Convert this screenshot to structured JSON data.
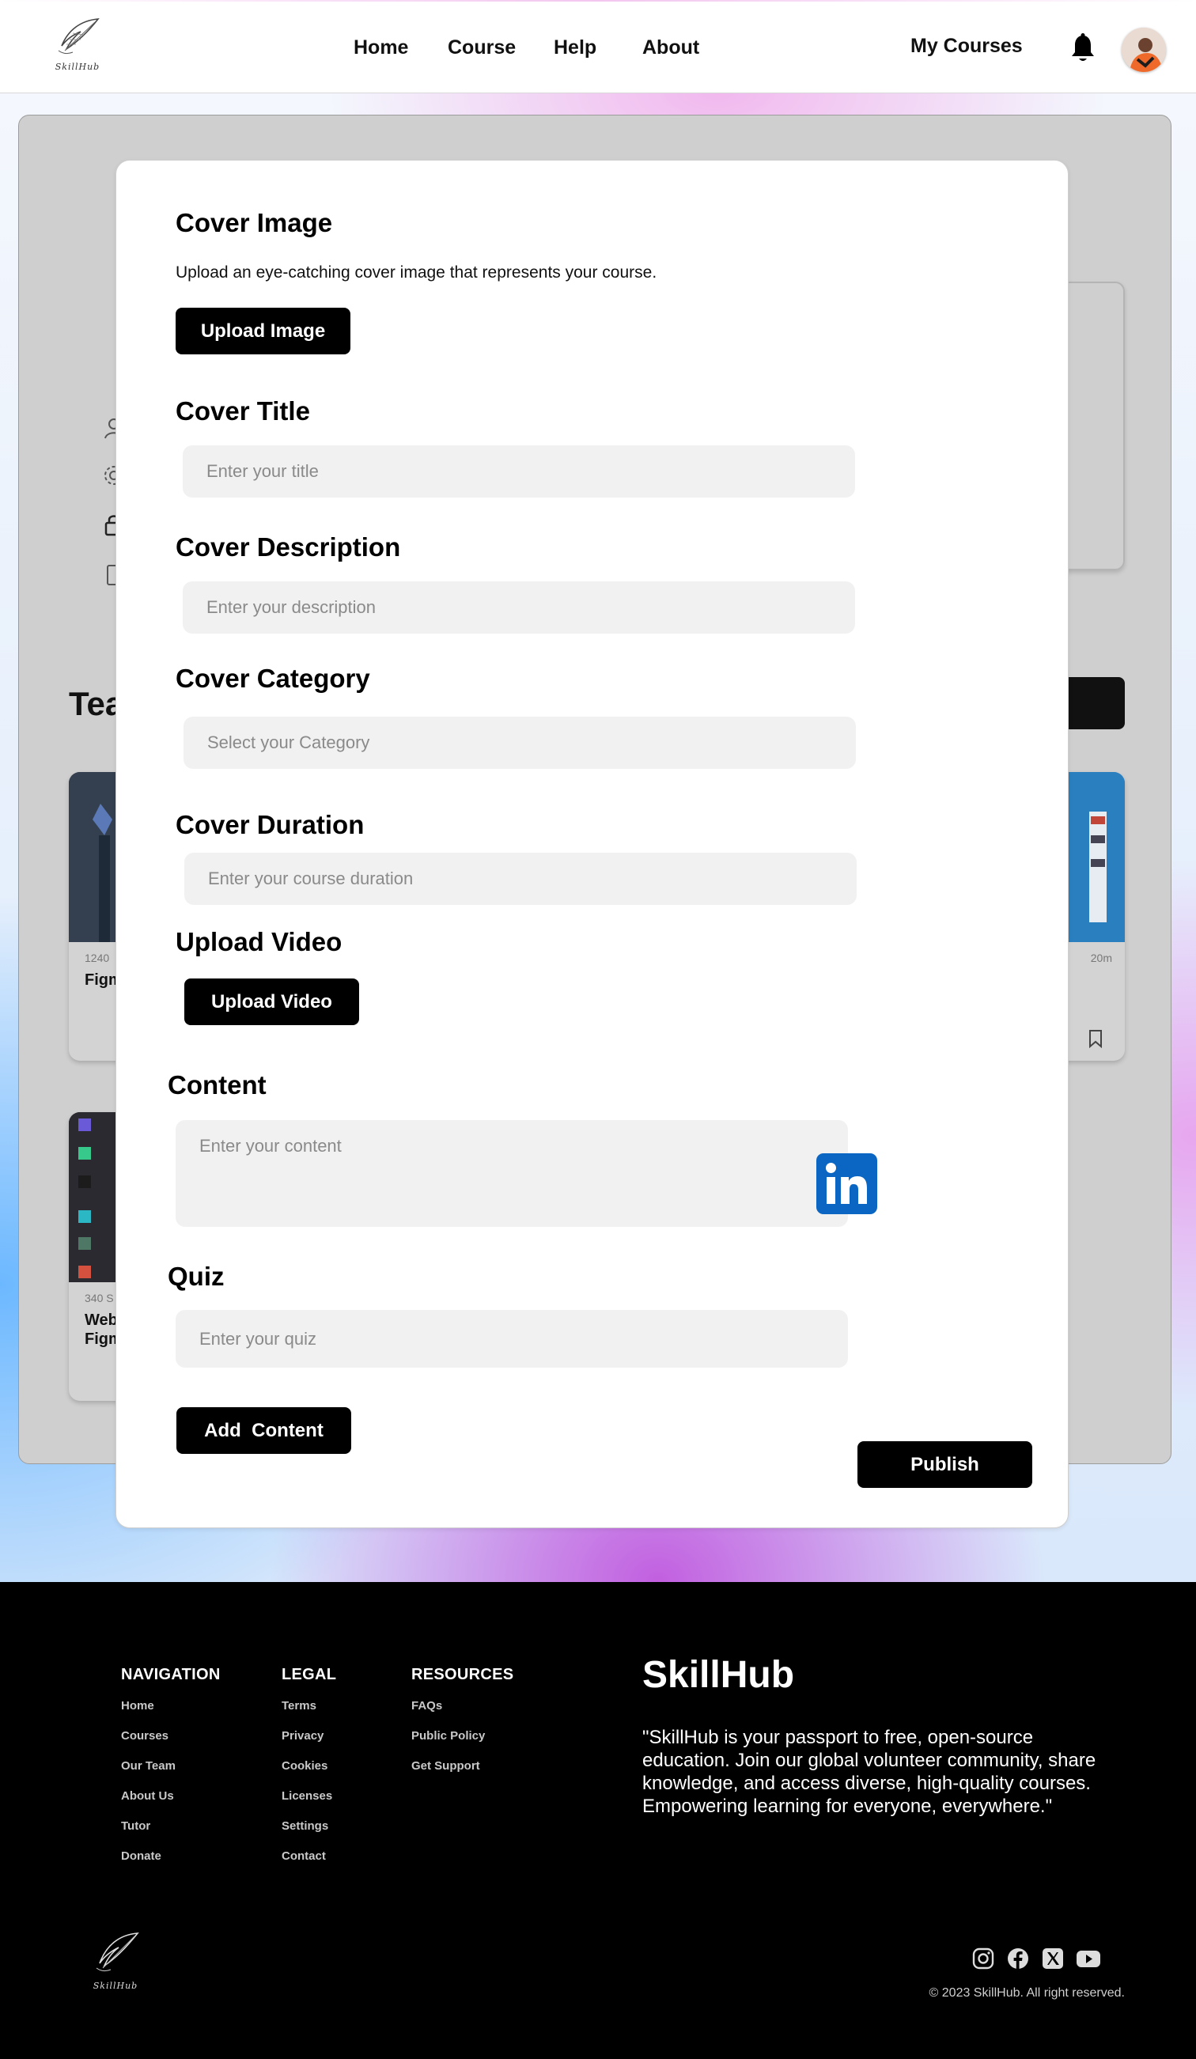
{
  "header": {
    "logo_text": "SkillHub",
    "nav": [
      "Home",
      "Course",
      "Help",
      "About"
    ],
    "my_courses": "My Courses"
  },
  "background": {
    "heading_fragment": "Tea",
    "cards": [
      {
        "meta": "1240",
        "title": "Figm"
      },
      {
        "meta": "20m",
        "title": ""
      },
      {
        "meta": "340 S",
        "title": "Web\nFigm"
      }
    ]
  },
  "modal": {
    "cover_image": {
      "heading": "Cover Image",
      "description": "Upload an eye-catching cover image that represents your course.",
      "button": "Upload Image"
    },
    "cover_title": {
      "heading": "Cover Title",
      "placeholder": "Enter your title"
    },
    "cover_description": {
      "heading": "Cover Description",
      "placeholder": "Enter your description"
    },
    "cover_category": {
      "heading": "Cover Category",
      "placeholder": "Select your Category"
    },
    "cover_duration": {
      "heading": "Cover Duration",
      "placeholder": "Enter your course duration"
    },
    "upload_video": {
      "heading": "Upload Video",
      "button": "Upload Video"
    },
    "content": {
      "heading": "Content",
      "placeholder": "Enter your content"
    },
    "quiz": {
      "heading": "Quiz",
      "placeholder": "Enter your quiz"
    },
    "add_content_button": "Add  Content",
    "publish_button": "Publish"
  },
  "footer": {
    "navigation": {
      "title": "NAVIGATION",
      "links": [
        "Home",
        "Courses",
        "Our Team",
        "About Us",
        "Tutor",
        "Donate"
      ]
    },
    "legal": {
      "title": "LEGAL",
      "links": [
        "Terms",
        "Privacy",
        "Cookies",
        "Licenses",
        "Settings",
        "Contact"
      ]
    },
    "resources": {
      "title": "RESOURCES",
      "links": [
        "FAQs",
        "Public Policy",
        "Get Support"
      ]
    },
    "brand": "SkillHub",
    "description": "\"SkillHub is your passport to free, open-source education. Join our global volunteer community, share knowledge, and access diverse, high-quality courses. Empowering learning for everyone, everywhere.\"",
    "logo_text": "SkillHub",
    "social_icons": [
      "instagram-icon",
      "facebook-icon",
      "x-icon",
      "youtube-icon"
    ],
    "copyright": "© 2023 SkillHub. All right reserved."
  },
  "colors": {
    "primary_button": "#000000",
    "input_background": "#f1f1f1",
    "linkedin_blue": "#0a66c2",
    "footer_background": "#000000"
  }
}
